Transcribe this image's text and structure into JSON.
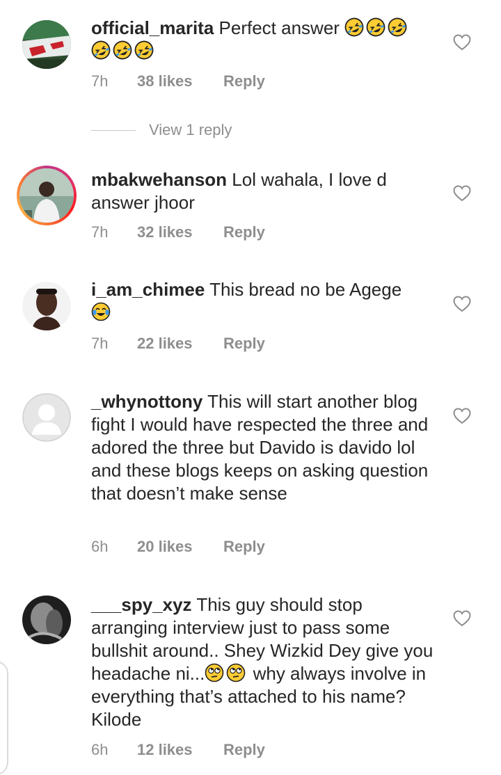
{
  "comments": [
    {
      "username": "official_marita",
      "text": "Perfect answer",
      "emojis_after": [
        "rofl-emoji",
        "rofl-emoji",
        "rofl-emoji",
        "rofl-emoji",
        "rofl-emoji",
        "rofl-emoji"
      ],
      "time": "7h",
      "likes": "38 likes",
      "reply": "Reply",
      "view_replies": "View 1 reply"
    },
    {
      "username": "mbakwehanson",
      "text": "Lol wahala, I love d answer jhoor",
      "has_story_ring": true,
      "time": "7h",
      "likes": "32 likes",
      "reply": "Reply"
    },
    {
      "username": "i_am_chimee",
      "text": "This bread no be Agege",
      "emojis_after": [
        "tears-of-joy-emoji"
      ],
      "time": "7h",
      "likes": "22 likes",
      "reply": "Reply"
    },
    {
      "username": "_whynottony",
      "text": "This will start another blog fight I would have respected the three and adored the three but Davido is davido lol and these blogs keeps on asking question that doesn’t make sense",
      "time": "6h",
      "likes": "20 likes",
      "reply": "Reply"
    },
    {
      "username": "___spy_xyz",
      "text_part1": "This guy should stop arranging interview just to pass some bullshit around.. Shey Wizkid Dey give you headache ni...",
      "text_part2": "why always involve in everything that’s attached to his name? Kilode",
      "emojis_mid": [
        "eye-roll-emoji",
        "eye-roll-emoji"
      ],
      "time": "6h",
      "likes": "12 likes",
      "reply": "Reply"
    }
  ],
  "colors": {
    "text": "#262626",
    "secondary": "#8e8e8e",
    "divider": "#c7c7c7"
  }
}
